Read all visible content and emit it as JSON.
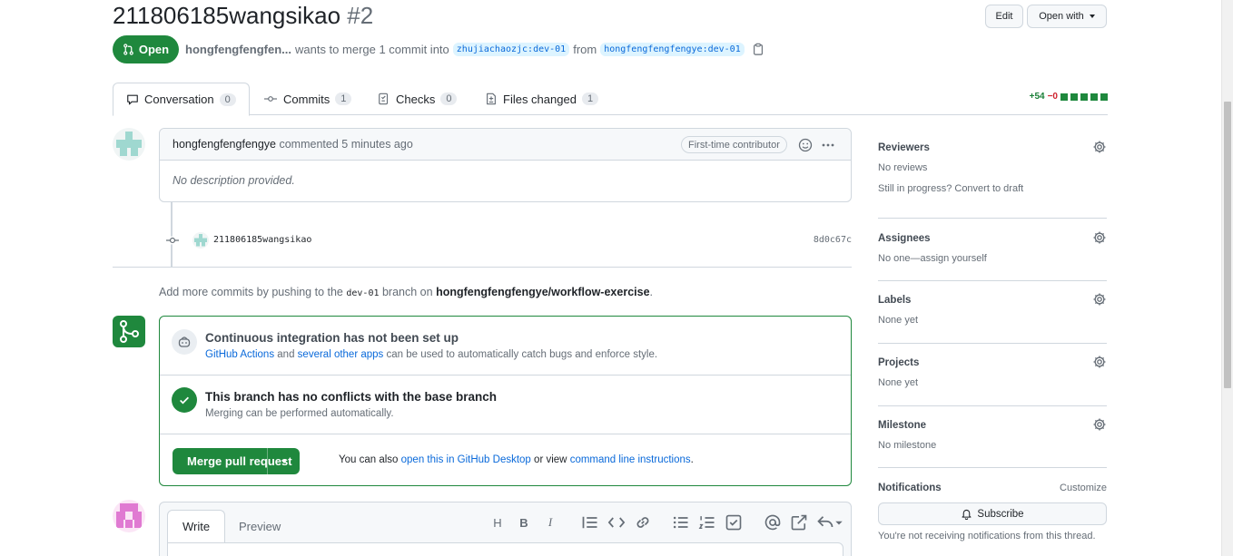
{
  "pr": {
    "title": "211806185wangsikao",
    "number": "#2",
    "state": "Open",
    "author": "hongfengfengfen...",
    "merge_text": "wants to merge 1 commit into",
    "base_branch": "zhujiachaozjc:dev-01",
    "from_text": "from",
    "head_branch": "hongfengfengfengye:dev-01"
  },
  "header_actions": {
    "edit_label": "Edit",
    "open_with_label": "Open with"
  },
  "tabs": [
    {
      "label": "Conversation",
      "count": "0"
    },
    {
      "label": "Commits",
      "count": "1"
    },
    {
      "label": "Checks",
      "count": "0"
    },
    {
      "label": "Files changed",
      "count": "1"
    }
  ],
  "diffstat": {
    "additions": "+54",
    "deletions": "−0"
  },
  "comment": {
    "author": "hongfengfengfengye",
    "action": "commented 5 minutes ago",
    "badge": "First-time contributor",
    "body": "No description provided."
  },
  "commit": {
    "user": "211806185wangsikao",
    "sha": "8d0c67c"
  },
  "push_hint": {
    "prefix": "Add more commits by pushing to the",
    "branch": "dev-01",
    "middle": "branch on",
    "repo": "hongfengfengfengye/workflow-exercise",
    "suffix": "."
  },
  "merge": {
    "ci_title": "Continuous integration has not been set up",
    "ci_link1": "GitHub Actions",
    "ci_and": "and",
    "ci_link2": "several other apps",
    "ci_rest": "can be used to automatically catch bugs and enforce style.",
    "conflict_title": "This branch has no conflicts with the base branch",
    "conflict_sub": "Merging can be performed automatically.",
    "button_label": "Merge pull request",
    "alt_prefix": "You can also",
    "alt_link1": "open this in GitHub Desktop",
    "alt_mid": "or view",
    "alt_link2": "command line instructions",
    "alt_suffix": "."
  },
  "editor": {
    "write_tab": "Write",
    "preview_tab": "Preview",
    "tools": [
      "H",
      "B",
      "I"
    ]
  },
  "sidebar": {
    "reviewers": {
      "label": "Reviewers",
      "value": "No reviews",
      "extra": "Still in progress? Convert to draft"
    },
    "assignees": {
      "label": "Assignees",
      "value": "No one—assign yourself"
    },
    "labels": {
      "label": "Labels",
      "value": "None yet"
    },
    "projects": {
      "label": "Projects",
      "value": "None yet"
    },
    "milestone": {
      "label": "Milestone",
      "value": "No milestone"
    },
    "notifications": {
      "label": "Notifications",
      "customize": "Customize",
      "subscribe_label": "Subscribe",
      "note": "You're not receiving notifications from this thread."
    }
  },
  "colors": {
    "primary_green": "#1f883d",
    "link_blue": "#0969da",
    "border": "#d0d7de",
    "muted_text": "#656d76"
  }
}
